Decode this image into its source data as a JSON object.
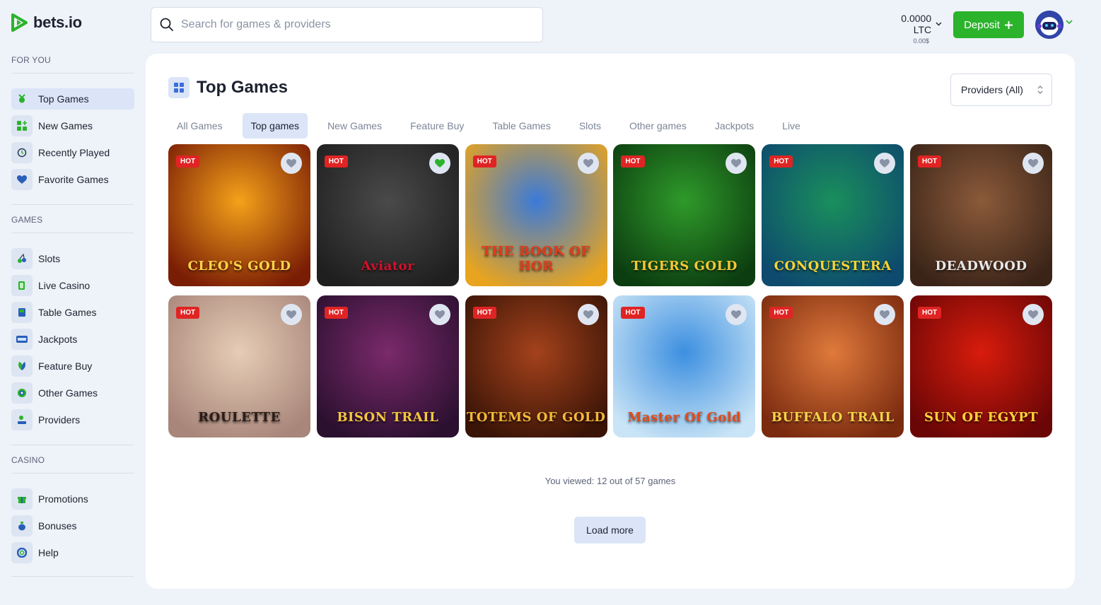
{
  "brand": {
    "name": "bets.io",
    "accent": "#2bb32b"
  },
  "search": {
    "placeholder": "Search for games & providers"
  },
  "header": {
    "balance": "0.0000 LTC",
    "balance_fiat": "0.00$",
    "deposit_label": "Deposit"
  },
  "sidebar": {
    "sections": [
      {
        "title": "FOR YOU",
        "items": [
          {
            "label": "Top Games",
            "icon": "medal-icon",
            "active": true
          },
          {
            "label": "New Games",
            "icon": "grid-plus-icon"
          },
          {
            "label": "Recently Played",
            "icon": "history-icon"
          },
          {
            "label": "Favorite Games",
            "icon": "heart-icon"
          }
        ]
      },
      {
        "title": "GAMES",
        "items": [
          {
            "label": "Slots",
            "icon": "cherries-icon"
          },
          {
            "label": "Live Casino",
            "icon": "cards-icon"
          },
          {
            "label": "Table Games",
            "icon": "table-icon"
          },
          {
            "label": "Jackpots",
            "icon": "jackpot-icon"
          },
          {
            "label": "Feature Buy",
            "icon": "leaf-icon"
          },
          {
            "label": "Other Games",
            "icon": "target-icon"
          },
          {
            "label": "Providers",
            "icon": "provider-icon"
          }
        ]
      },
      {
        "title": "CASINO",
        "items": [
          {
            "label": "Promotions",
            "icon": "gift-icon"
          },
          {
            "label": "Bonuses",
            "icon": "moneybag-icon"
          },
          {
            "label": "Help",
            "icon": "lifebuoy-icon"
          }
        ]
      }
    ]
  },
  "main": {
    "title": "Top Games",
    "providers_filter": "Providers (All)",
    "tabs": [
      {
        "label": "All Games"
      },
      {
        "label": "Top games",
        "active": true
      },
      {
        "label": "New Games"
      },
      {
        "label": "Feature Buy"
      },
      {
        "label": "Table Games"
      },
      {
        "label": "Slots"
      },
      {
        "label": "Other games"
      },
      {
        "label": "Jackpots"
      },
      {
        "label": "Live"
      }
    ],
    "badge_label": "HOT",
    "games": [
      {
        "name": "CLEO'S GOLD",
        "favorite": false,
        "colors": [
          "#f4a21a",
          "#7a1d05"
        ],
        "text_color": "#ffd24a"
      },
      {
        "name": "Aviator",
        "favorite": true,
        "colors": [
          "#4a4a4a",
          "#1f1f1f"
        ],
        "text_color": "#d4102c"
      },
      {
        "name": "THE BOOK OF HOR",
        "favorite": false,
        "colors": [
          "#3b7ad8",
          "#e8a41f"
        ],
        "text_color": "#e03a1c"
      },
      {
        "name": "TIGERS GOLD",
        "favorite": false,
        "colors": [
          "#2f9a2a",
          "#0c3d10"
        ],
        "text_color": "#f6c737"
      },
      {
        "name": "CONQUESTERA",
        "favorite": false,
        "colors": [
          "#1a8f5c",
          "#0d4a6e"
        ],
        "text_color": "#f6d437"
      },
      {
        "name": "DEADWOOD",
        "favorite": false,
        "colors": [
          "#8b5a3a",
          "#3a2418"
        ],
        "text_color": "#e8e8e8"
      },
      {
        "name": "ROULETTE",
        "favorite": false,
        "colors": [
          "#e6cdb6",
          "#a8867a"
        ],
        "text_color": "#2a1b18"
      },
      {
        "name": "BISON TRAIL",
        "favorite": false,
        "colors": [
          "#7a2a6a",
          "#2b1030"
        ],
        "text_color": "#f5c640"
      },
      {
        "name": "TOTEMS OF GOLD",
        "favorite": false,
        "colors": [
          "#a4421c",
          "#3a1406"
        ],
        "text_color": "#f3b83a"
      },
      {
        "name": "Master Of Gold",
        "favorite": false,
        "colors": [
          "#3c8fe0",
          "#c9e4f6"
        ],
        "text_color": "#e24b1a"
      },
      {
        "name": "BUFFALO TRAIL",
        "favorite": false,
        "colors": [
          "#e07a3c",
          "#7a2a0f"
        ],
        "text_color": "#f6d24a"
      },
      {
        "name": "SUN OF EGYPT",
        "favorite": false,
        "colors": [
          "#d81c0c",
          "#6a0606"
        ],
        "text_color": "#ffd23a"
      }
    ],
    "viewed_text": "You viewed: 12 out of 57 games",
    "load_more_label": "Load more"
  }
}
